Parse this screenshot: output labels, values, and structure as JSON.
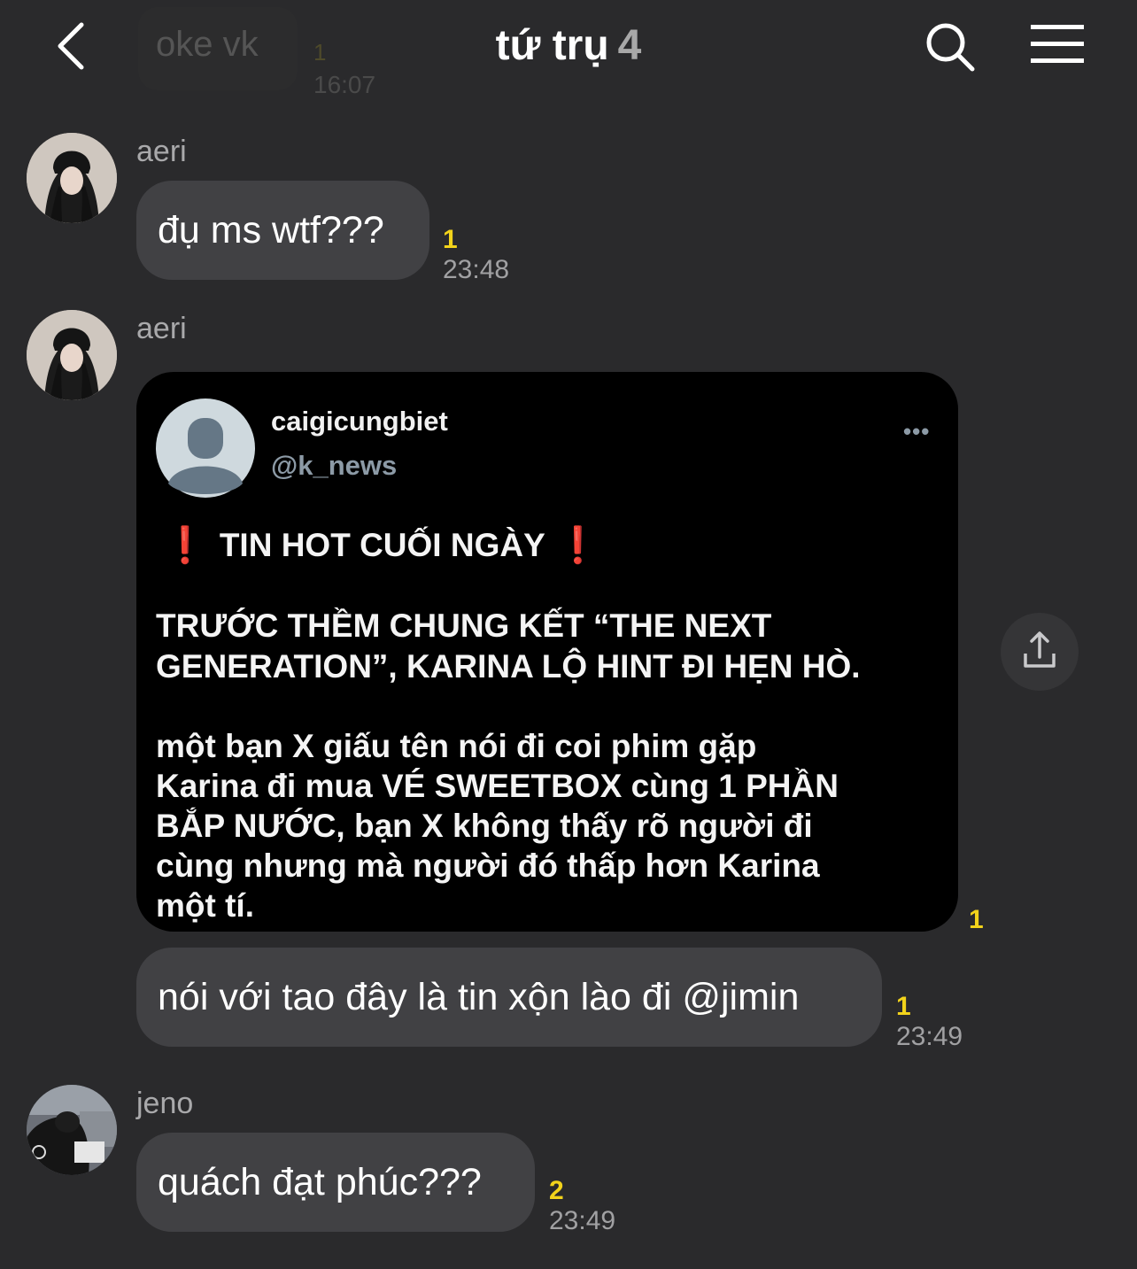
{
  "header": {
    "title": "tứ trụ",
    "member_count": "4",
    "faded_message": {
      "text": "oke vk",
      "unread": "1",
      "time": "16:07"
    }
  },
  "messages": [
    {
      "sender": "aeri",
      "text": "đụ ms wtf???",
      "unread": "1",
      "time": "23:48"
    },
    {
      "sender": "aeri",
      "image_unread": "1",
      "text": "nói với tao đây là tin xộn lào đi @jimin",
      "unread": "1",
      "time": "23:49"
    },
    {
      "sender": "jeno",
      "text": "quách đạt phúc???",
      "unread": "2",
      "time": "23:49"
    }
  ],
  "tweet": {
    "display_name": "caigicungbiet",
    "handle": "@k_news",
    "more": "•••",
    "excl": "❗",
    "headline": "TIN HOT CUỐI NGÀY",
    "para1_line1": "TRƯỚC THỀM CHUNG KẾT “THE NEXT",
    "para1_line2": "GENERATION”, KARINA LỘ HINT ĐI HẸN HÒ.",
    "para2_line1": "một bạn X giấu tên nói đi coi phim gặp",
    "para2_line2": "Karina đi mua VÉ SWEETBOX cùng 1 PHẦN",
    "para2_line3": "BẮP NƯỚC, bạn X không thấy rõ người đi",
    "para2_line4": "cùng nhưng mà người đó thấp hơn Karina",
    "para2_line5": "một tí."
  },
  "icons": {
    "back": "chevron-left-icon",
    "search": "search-icon",
    "menu": "hamburger-menu-icon",
    "share": "share-icon"
  },
  "colors": {
    "background": "#2a2a2c",
    "bubble": "#414144",
    "unread": "#f2d31b",
    "tweet_excl": "#e0252d"
  }
}
